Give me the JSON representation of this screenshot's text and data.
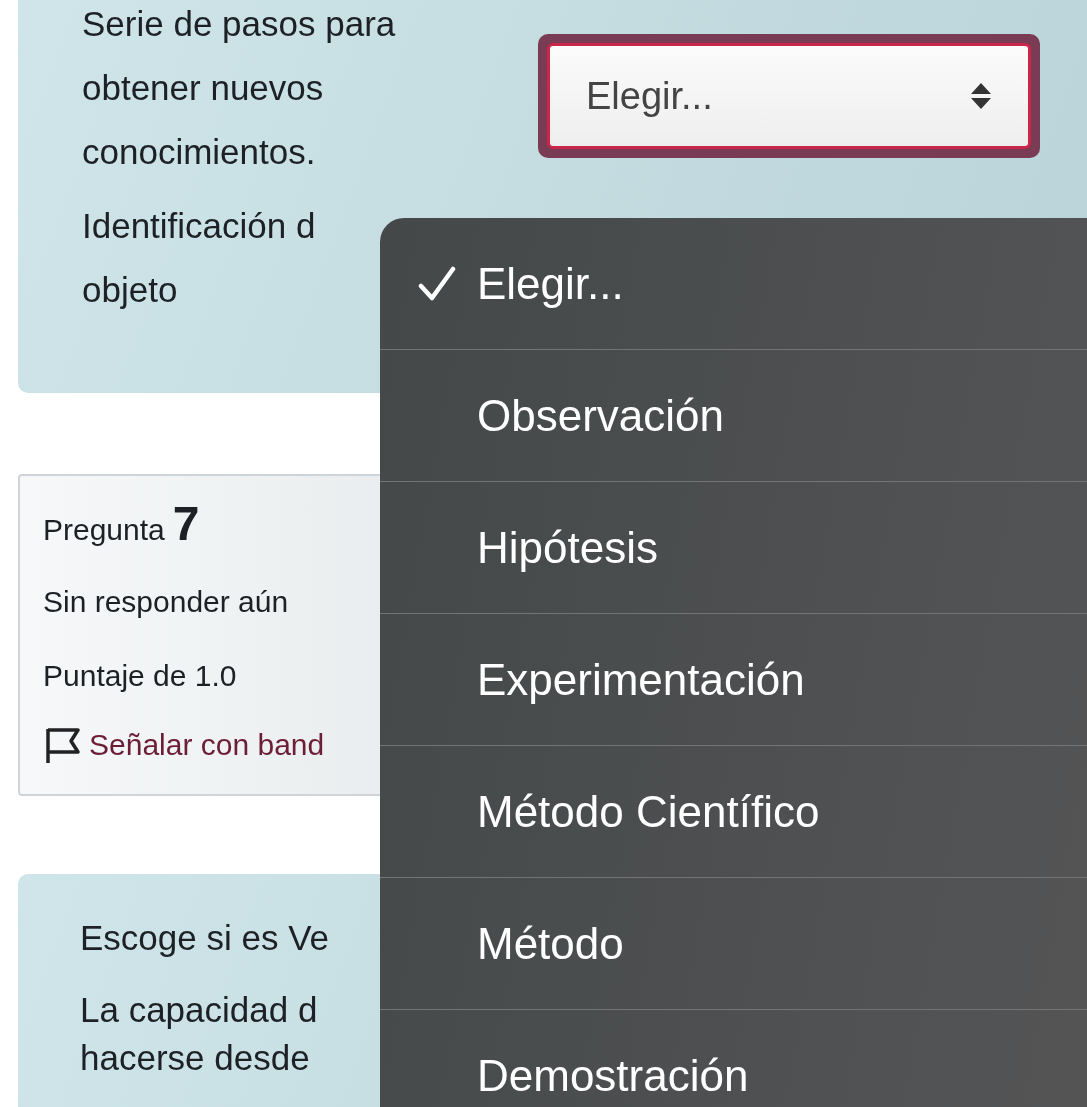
{
  "question_6": {
    "prompt": "Serie de pasos para obtener nuevos conocimientos.",
    "select": {
      "value": "Elegir..."
    },
    "next_prompt": "Identificación d objeto"
  },
  "question_7_info": {
    "label": "Pregunta",
    "number": "7",
    "status": "Sin responder aún",
    "score": "Puntaje de 1.0",
    "flag_link": "Señalar con band"
  },
  "question_8": {
    "title": "Escoge si es Ve",
    "text": "La capacidad d hacerse desde"
  },
  "dropdown": {
    "options": [
      {
        "label": "Elegir...",
        "selected": true
      },
      {
        "label": "Observación",
        "selected": false
      },
      {
        "label": "Hipótesis",
        "selected": false
      },
      {
        "label": "Experimentación",
        "selected": false
      },
      {
        "label": "Método Científico",
        "selected": false
      },
      {
        "label": "Método",
        "selected": false
      },
      {
        "label": "Demostración",
        "selected": false
      }
    ]
  }
}
